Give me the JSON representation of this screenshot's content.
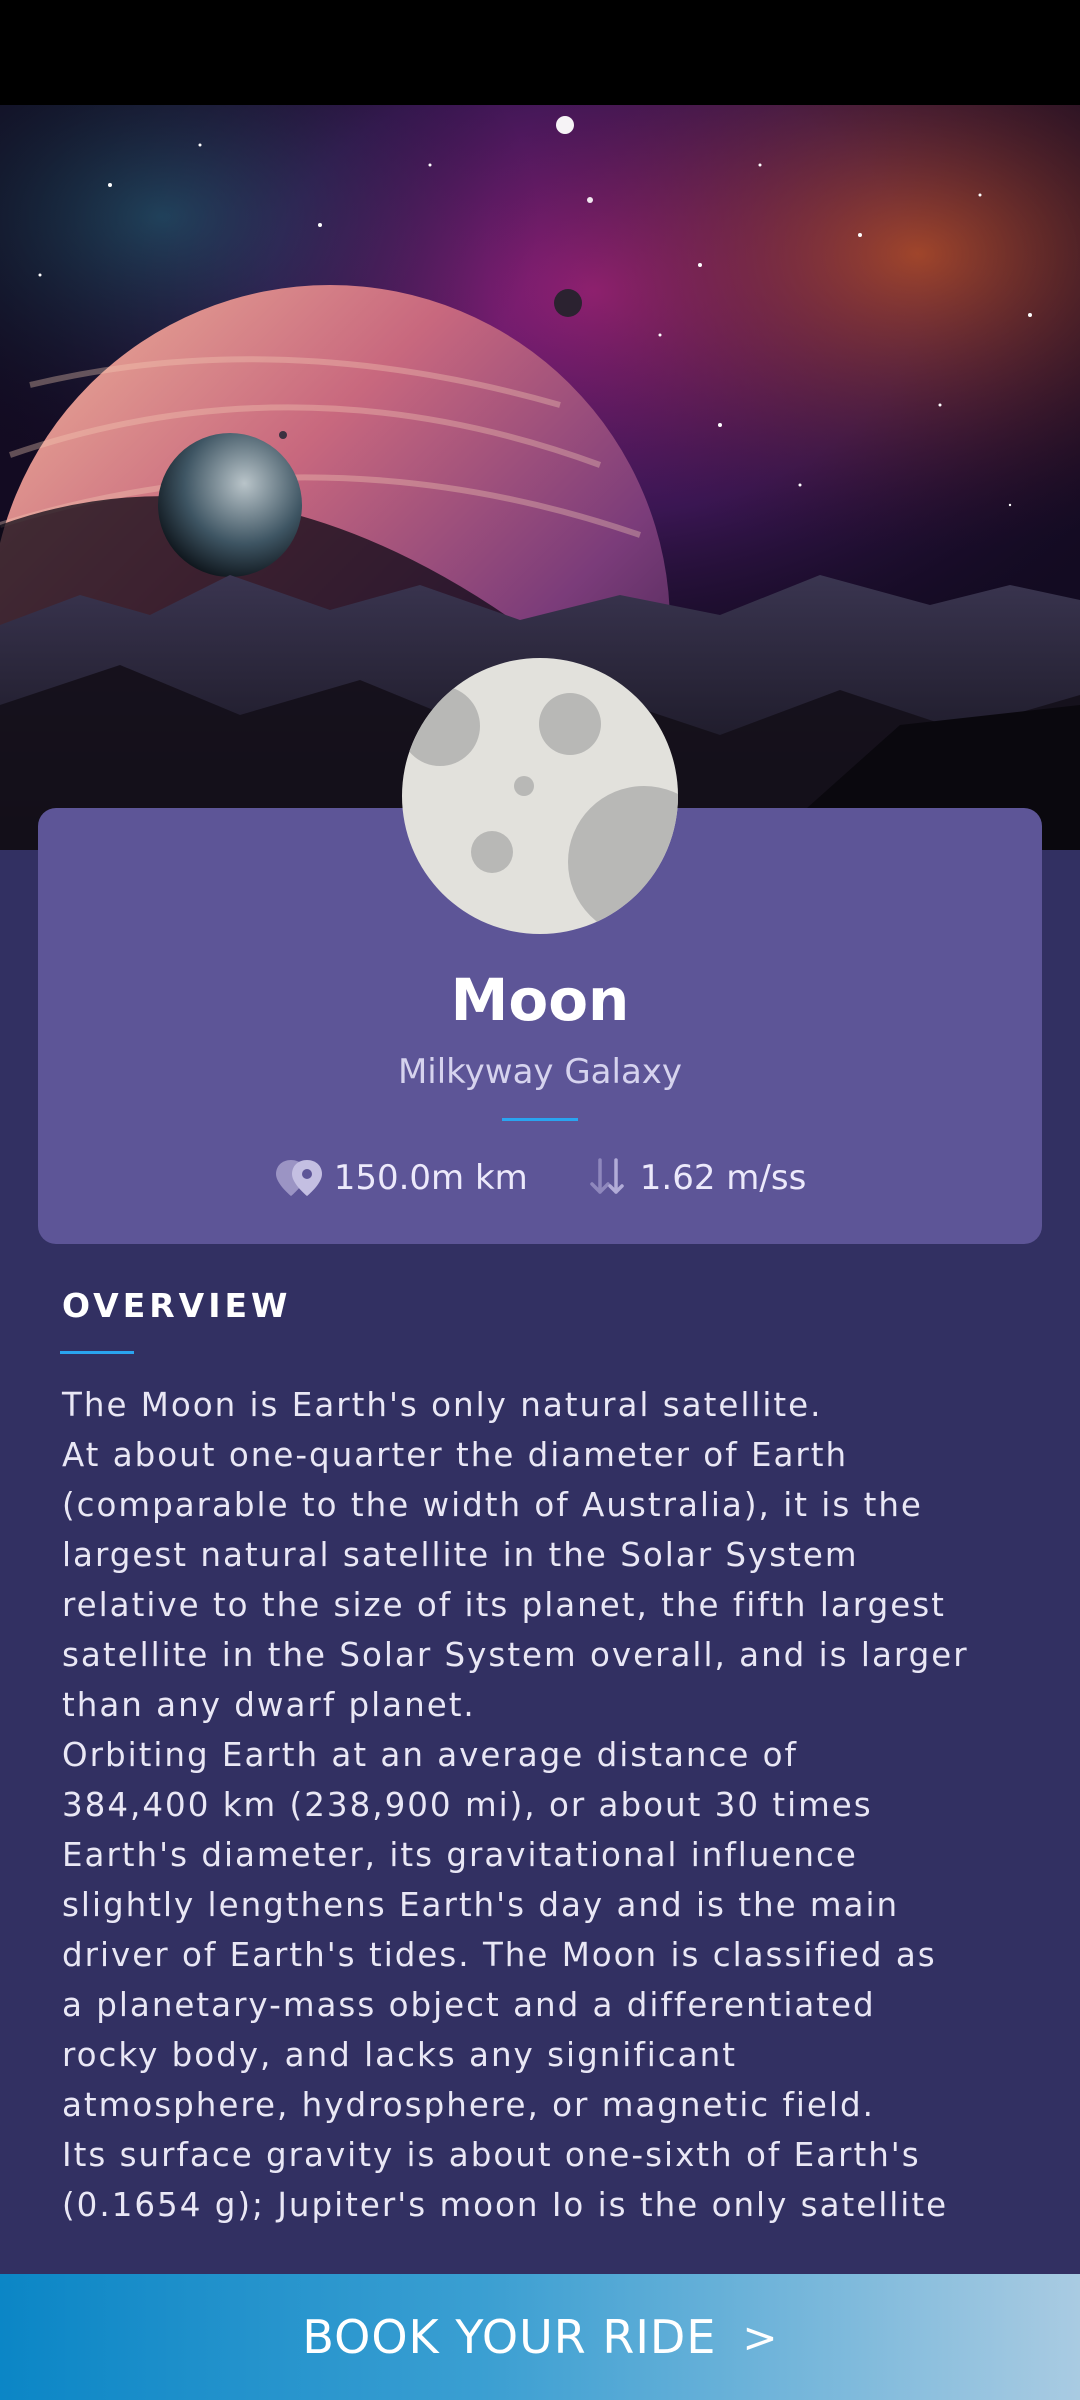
{
  "planet": {
    "name": "Moon",
    "galaxy": "Milkyway Galaxy",
    "distance": "150.0m km",
    "gravity": "1.62 m/ss",
    "distance_icon": "location-pin-icon",
    "gravity_icon": "gravity-arrow-icon"
  },
  "overview": {
    "heading": "OVERVIEW",
    "lines": [
      "The Moon is Earth's only natural satellite.",
      "At about one-quarter the diameter of Earth",
      "(comparable to the width of Australia), it is the",
      "largest natural satellite in the Solar System",
      "relative to the size of its planet, the fifth largest",
      "satellite in the Solar System overall, and is larger",
      "than any dwarf planet.",
      "Orbiting Earth at an average distance of",
      "384,400 km (238,900 mi), or about 30 times",
      "Earth's diameter, its gravitational influence",
      "slightly lengthens Earth's day and is the main",
      "driver of Earth's tides. The Moon is classified as",
      "a planetary-mass object and a differentiated",
      "rocky body, and lacks any significant",
      "atmosphere, hydrosphere, or magnetic field.",
      "Its surface gravity is about one-sixth of Earth's",
      "(0.1654 g); Jupiter's moon Io is the only satellite"
    ]
  },
  "cta": {
    "label": "BOOK YOUR RIDE",
    "chevron": ">"
  },
  "colors": {
    "page_background": "#323062",
    "card_background": "#5d5597",
    "accent": "#2aa4f0"
  }
}
